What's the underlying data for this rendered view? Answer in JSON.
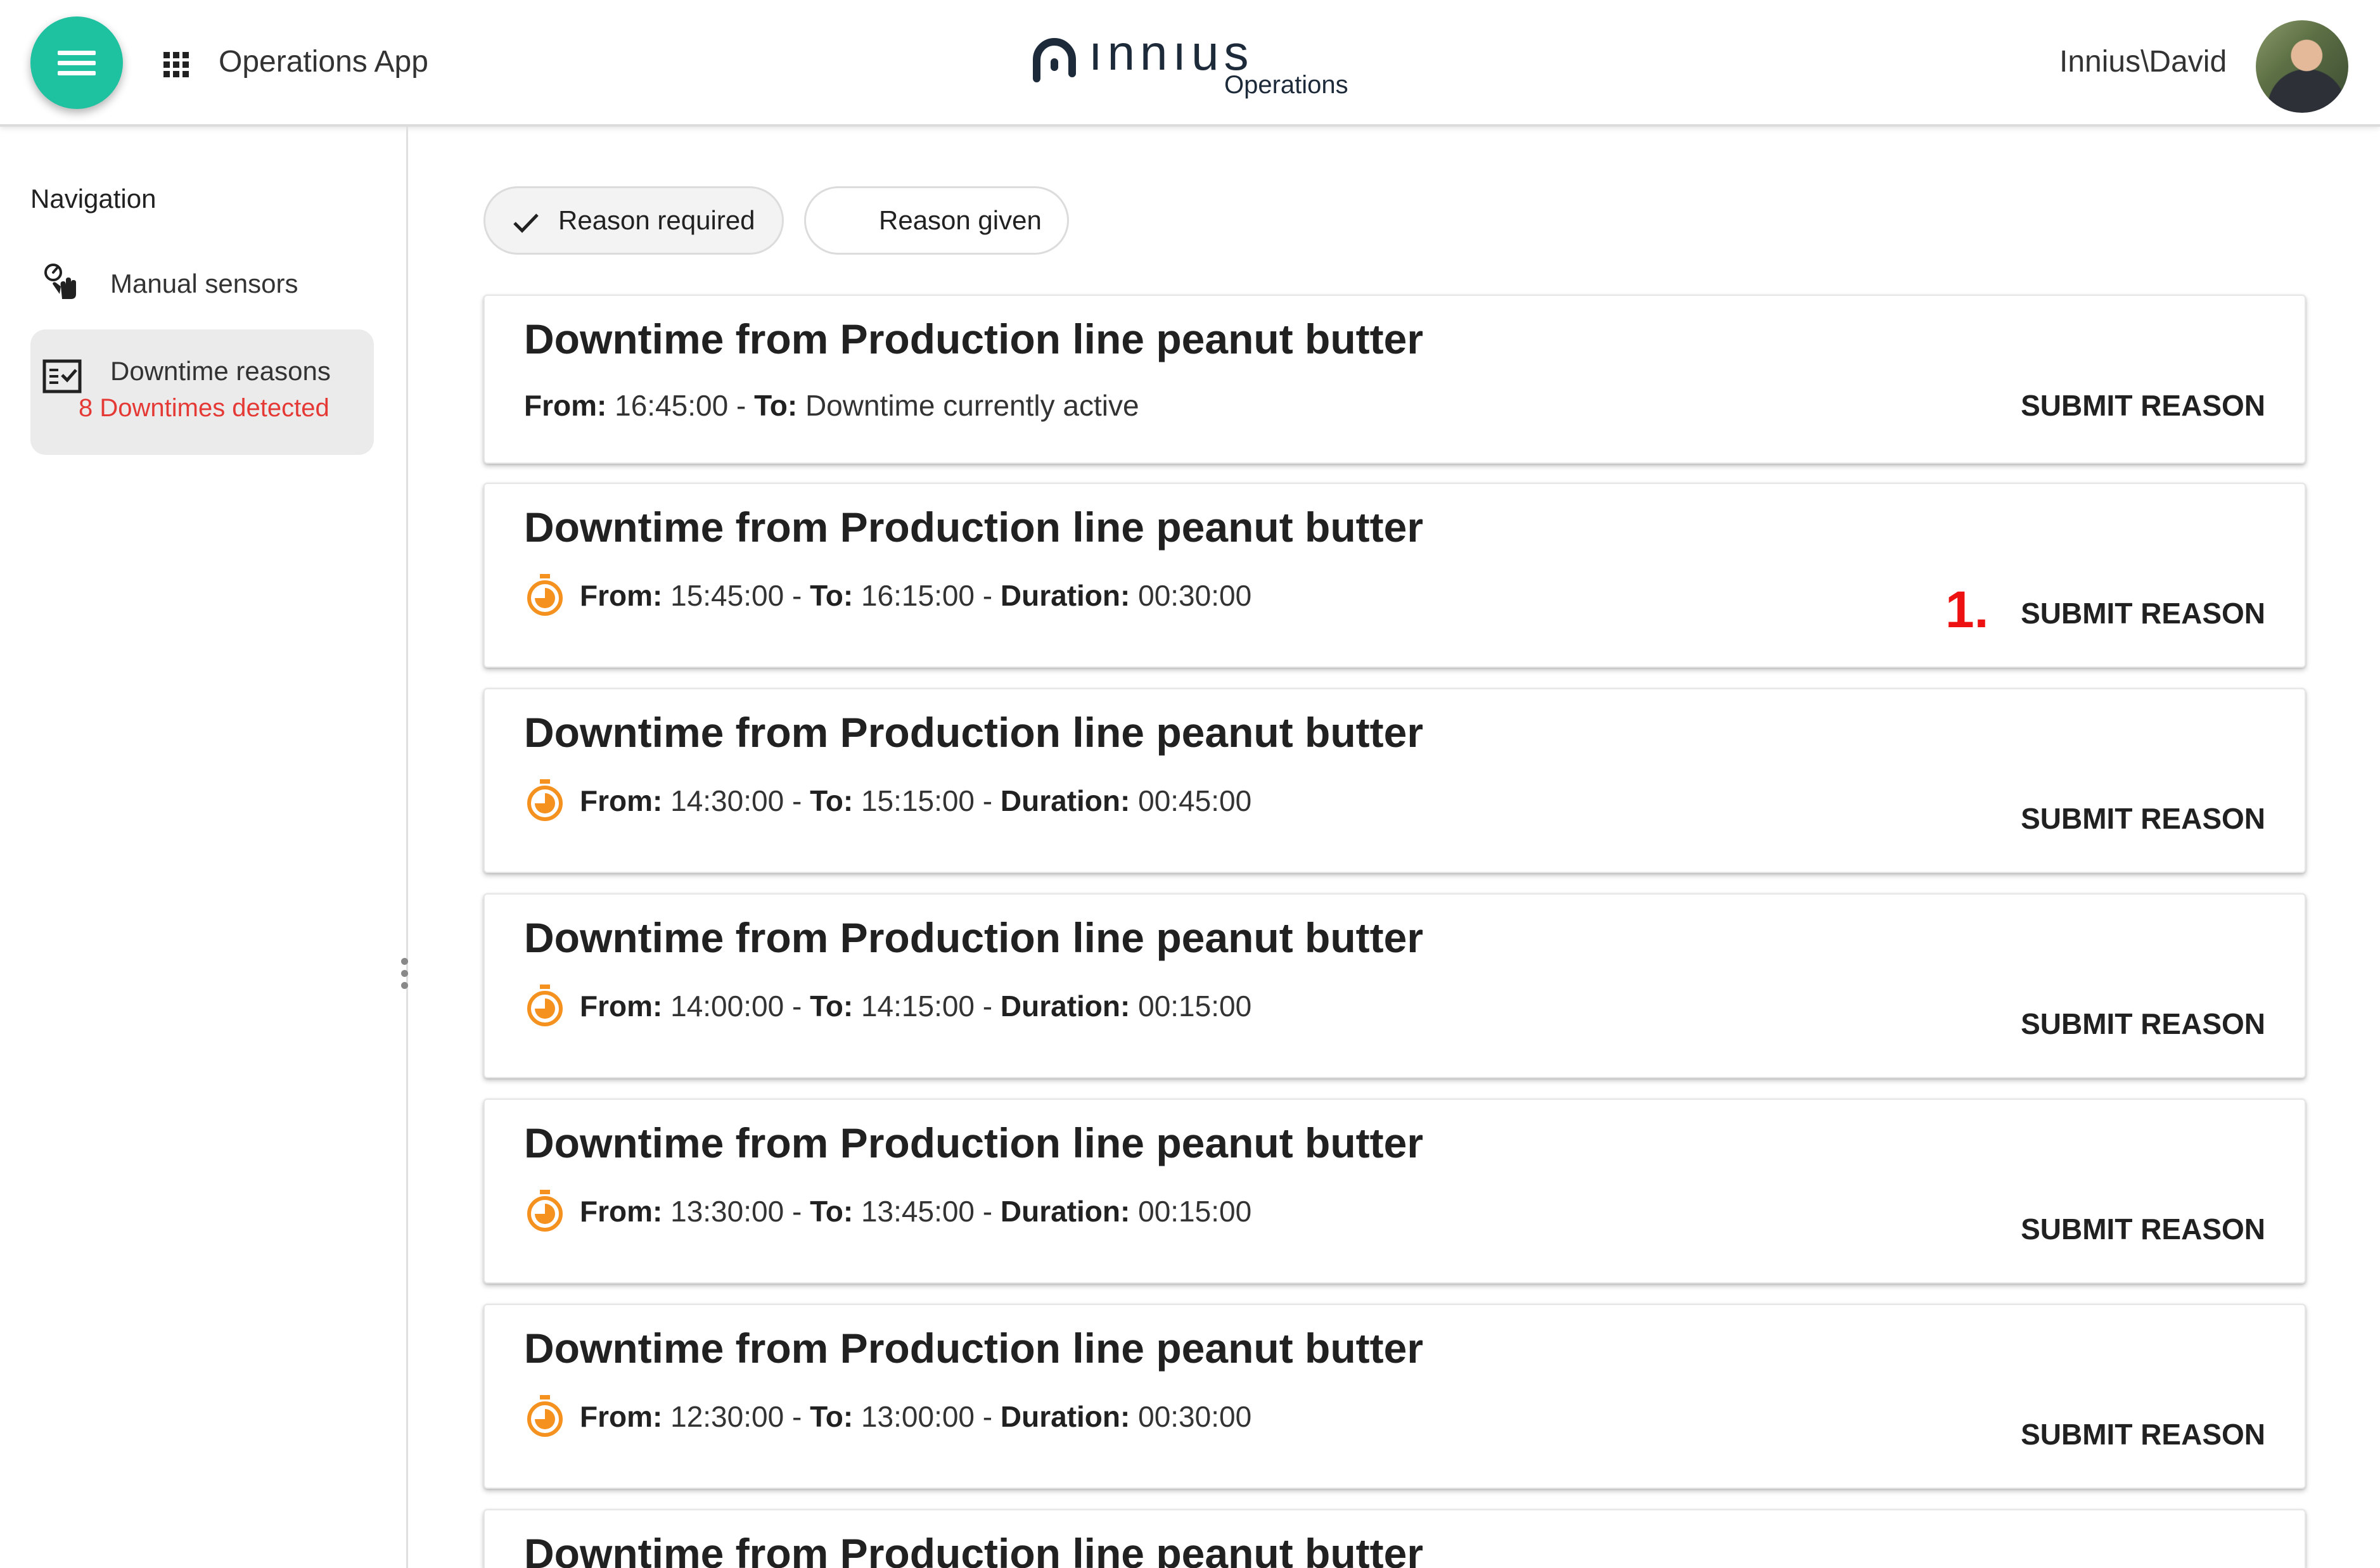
{
  "header": {
    "app_title": "Operations App",
    "logo_word": "ınnıus",
    "logo_sub": "Operations",
    "user_name": "Innius\\David",
    "accent_color": "#1fc2a0",
    "icons": [
      "menu-icon",
      "apps-icon",
      "innius-logo",
      "avatar"
    ]
  },
  "sidebar": {
    "heading": "Navigation",
    "items": [
      {
        "label": "Manual sensors",
        "icon": "touch-gauge-icon"
      },
      {
        "label": "Downtime reasons",
        "sub": "8 Downtimes detected",
        "icon": "checklist-icon",
        "selected": true
      }
    ]
  },
  "filters": {
    "required_label": "Reason required",
    "required_selected": true,
    "given_label": "Reason given"
  },
  "step_marker": "1.",
  "downtimes": [
    {
      "title": "Downtime from Production line peanut butter",
      "from_label": "From:",
      "from": "16:45:00",
      "to_label": "To:",
      "to": "Downtime currently active",
      "action": "SUBMIT REASON"
    },
    {
      "title": "Downtime from Production line peanut butter",
      "from_label": "From:",
      "from": "15:45:00",
      "to_label": "To:",
      "to": "16:15:00",
      "duration_label": "Duration:",
      "duration": "00:30:00",
      "action": "SUBMIT REASON"
    },
    {
      "title": "Downtime from Production line peanut butter",
      "from_label": "From:",
      "from": "14:30:00",
      "to_label": "To:",
      "to": "15:15:00",
      "duration_label": "Duration:",
      "duration": "00:45:00",
      "action": "SUBMIT REASON"
    },
    {
      "title": "Downtime from Production line peanut butter",
      "from_label": "From:",
      "from": "14:00:00",
      "to_label": "To:",
      "to": "14:15:00",
      "duration_label": "Duration:",
      "duration": "00:15:00",
      "action": "SUBMIT REASON"
    },
    {
      "title": "Downtime from Production line peanut butter",
      "from_label": "From:",
      "from": "13:30:00",
      "to_label": "To:",
      "to": "13:45:00",
      "duration_label": "Duration:",
      "duration": "00:15:00",
      "action": "SUBMIT REASON"
    },
    {
      "title": "Downtime from Production line peanut butter",
      "from_label": "From:",
      "from": "12:30:00",
      "to_label": "To:",
      "to": "13:00:00",
      "duration_label": "Duration:",
      "duration": "00:30:00",
      "action": "SUBMIT REASON"
    },
    {
      "title": "Downtime from Production line peanut butter"
    }
  ],
  "timer_color": "#f5911e"
}
